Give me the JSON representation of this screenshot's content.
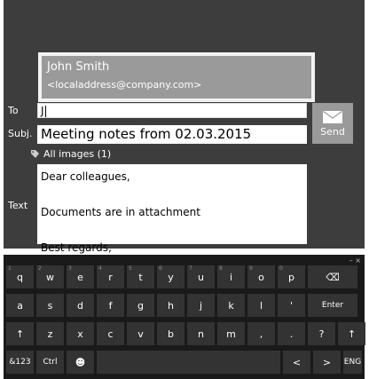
{
  "compose": {
    "suggestion": {
      "name": "John Smith",
      "email": "<localaddress@company.com>"
    },
    "to_label": "To",
    "to_value": "J",
    "subj_label": "Subj.",
    "subj_value": "Meeting notes from 02.03.2015",
    "send_label": "Send",
    "attachments_label": "All images (1)",
    "text_label": "Text",
    "body_lines": [
      "Dear colleagues,",
      "",
      "Documents are in attachment",
      "",
      "Best regards,"
    ]
  },
  "keyboard": {
    "top_controls": "–  ×",
    "row1": [
      {
        "label": "q",
        "sub": "1"
      },
      {
        "label": "w",
        "sub": "2"
      },
      {
        "label": "e",
        "sub": "3"
      },
      {
        "label": "r",
        "sub": "4"
      },
      {
        "label": "t",
        "sub": "5"
      },
      {
        "label": "y",
        "sub": "6"
      },
      {
        "label": "u",
        "sub": "7"
      },
      {
        "label": "i",
        "sub": "8"
      },
      {
        "label": "o",
        "sub": "9"
      },
      {
        "label": "p",
        "sub": "0"
      },
      {
        "label": "⌫",
        "sub": ""
      }
    ],
    "row2": [
      "a",
      "s",
      "d",
      "f",
      "g",
      "h",
      "j",
      "k",
      "l",
      "'",
      "Enter"
    ],
    "row3": [
      "↑",
      "z",
      "x",
      "c",
      "v",
      "b",
      "n",
      "m",
      ",",
      ".",
      "?",
      "↑"
    ],
    "row4": [
      "&123",
      "Ctrl",
      "☻",
      "",
      "<",
      ">",
      "ENG"
    ]
  },
  "colors": {
    "panel_bg": "#3d3d3d",
    "accent_grey": "#9a9a9a",
    "keyboard_bg": "#1a1a1a",
    "key_bg": "#333333"
  }
}
